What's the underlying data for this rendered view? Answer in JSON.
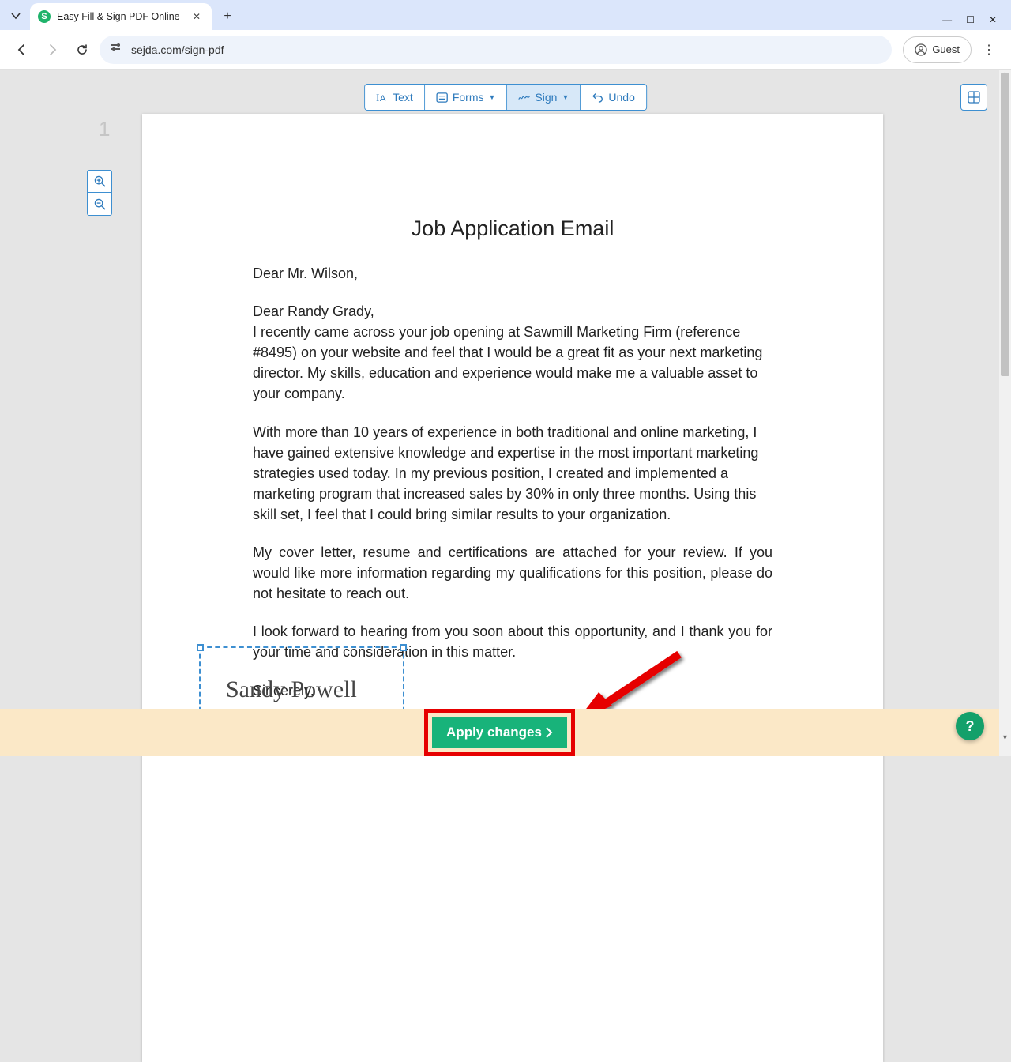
{
  "browser": {
    "tab_title": "Easy Fill & Sign PDF Online",
    "url": "sejda.com/sign-pdf",
    "guest_label": "Guest"
  },
  "toolbar": {
    "text": "Text",
    "forms": "Forms",
    "sign": "Sign",
    "undo": "Undo"
  },
  "page_number": "1",
  "document": {
    "title": "Job Application Email",
    "greeting1": "Dear Mr. Wilson,",
    "greeting2": "Dear Randy Grady,",
    "p1": "I recently came across your job opening at Sawmill Marketing Firm (reference #8495) on your website and feel that I would be a great fit as your next marketing director. My skills, education and experience would make me a valuable asset to your company.",
    "p2": "With more than 10 years of experience in both traditional and online marketing, I have gained extensive knowledge and expertise in the most important marketing strategies used today. In my previous position, I created and implemented a marketing program that increased sales by 30% in only three months. Using this skill set, I feel that I could bring similar results to your organization.",
    "p3": "My cover letter, resume and certifications are attached for your review. If you would like more information regarding my qualifications for this position, please do not hesitate to reach out.",
    "p4": "I look forward to hearing from you soon about this opportunity, and I thank you for your time and consideration in this matter.",
    "closing": "Sincerely,",
    "signature": "Sandy Powell"
  },
  "apply_label": "Apply changes",
  "help_label": "?",
  "colors": {
    "accent": "#3d8fd1",
    "primary_green": "#18b37a",
    "annotation_red": "#e60000",
    "footer_bg": "#fbe8c7"
  }
}
